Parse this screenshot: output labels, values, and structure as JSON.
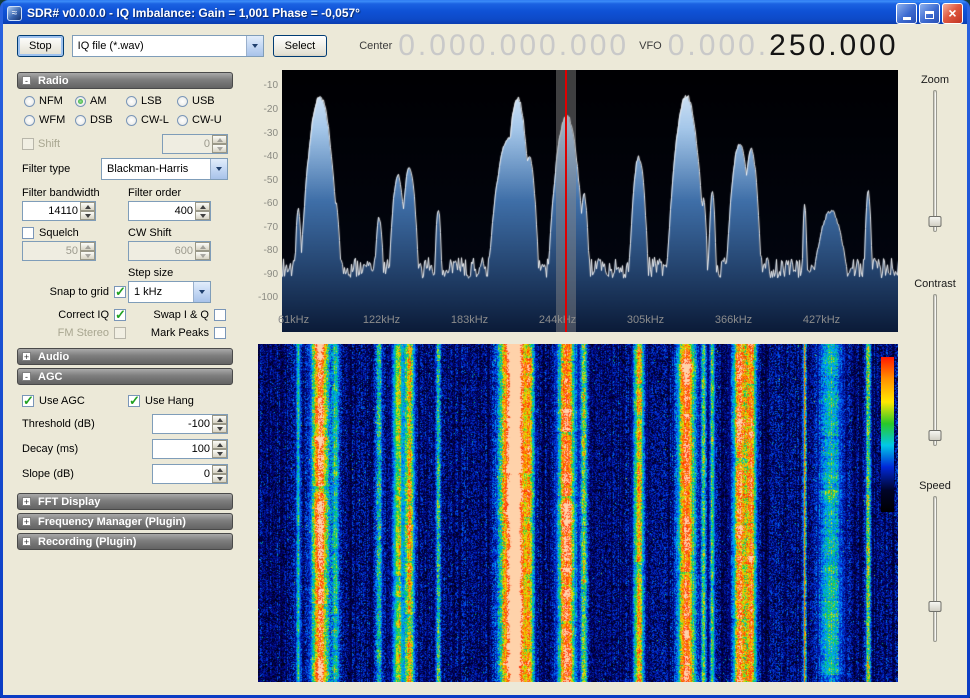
{
  "window": {
    "title": "SDR# v0.0.0.0 - IQ Imbalance: Gain = 1,001 Phase = -0,057°"
  },
  "toolbar": {
    "stop": "Stop",
    "source": "IQ file (*.wav)",
    "select": "Select",
    "center_label": "Center",
    "center_value": "0.000.000.000",
    "vfo_label": "VFO",
    "vfo_dim": "0.000.",
    "vfo_active": "250.000"
  },
  "panels": {
    "radio": {
      "title": "Radio",
      "glyph": "-",
      "modes": [
        {
          "label": "NFM",
          "selected": false
        },
        {
          "label": "AM",
          "selected": true
        },
        {
          "label": "LSB",
          "selected": false
        },
        {
          "label": "USB",
          "selected": false
        },
        {
          "label": "WFM",
          "selected": false
        },
        {
          "label": "DSB",
          "selected": false
        },
        {
          "label": "CW-L",
          "selected": false
        },
        {
          "label": "CW-U",
          "selected": false
        }
      ],
      "shift": {
        "label": "Shift",
        "value": "0",
        "checked": false,
        "enabled": false
      },
      "filter_type": {
        "label": "Filter type",
        "value": "Blackman-Harris"
      },
      "filter_bandwidth": {
        "label": "Filter bandwidth",
        "value": "14110"
      },
      "filter_order": {
        "label": "Filter order",
        "value": "400"
      },
      "squelch": {
        "label": "Squelch",
        "value": "50",
        "checked": false,
        "enabled": false
      },
      "cw_shift": {
        "label": "CW Shift",
        "value": "600",
        "enabled": false
      },
      "step_size": {
        "label": "Step size",
        "value": "1 kHz"
      },
      "snap_to_grid": {
        "label": "Snap to grid",
        "checked": true
      },
      "correct_iq": {
        "label": "Correct IQ",
        "checked": true
      },
      "swap_iq": {
        "label": "Swap I & Q",
        "checked": false
      },
      "fm_stereo": {
        "label": "FM Stereo",
        "checked": false,
        "enabled": false
      },
      "mark_peaks": {
        "label": "Mark Peaks",
        "checked": false
      }
    },
    "audio": {
      "title": "Audio",
      "glyph": "+"
    },
    "agc": {
      "title": "AGC",
      "glyph": "-",
      "use_agc": {
        "label": "Use AGC",
        "checked": true
      },
      "use_hang": {
        "label": "Use Hang",
        "checked": true
      },
      "threshold": {
        "label": "Threshold (dB)",
        "value": "-100"
      },
      "decay": {
        "label": "Decay (ms)",
        "value": "100"
      },
      "slope": {
        "label": "Slope (dB)",
        "value": "0"
      }
    },
    "fft": {
      "title": "FFT Display",
      "glyph": "+"
    },
    "freq_manager": {
      "title": "Frequency Manager (Plugin)",
      "glyph": "+"
    },
    "recording": {
      "title": "Recording (Plugin)",
      "glyph": "+"
    }
  },
  "sliders": [
    {
      "label": "Zoom",
      "position": 0.97
    },
    {
      "label": "Contrast",
      "position": 0.97
    },
    {
      "label": "Speed",
      "position": 0.78
    }
  ],
  "chart_data": {
    "type": "area",
    "title": "FFT spectrum with waterfall",
    "x_axis": {
      "tick_labels": [
        "61kHz",
        "122kHz",
        "183kHz",
        "244kHz",
        "305kHz",
        "366kHz",
        "427kHz"
      ],
      "ticks_khz": [
        61,
        122,
        183,
        244,
        305,
        366,
        427
      ],
      "range_khz": [
        53,
        480
      ]
    },
    "y_axis": {
      "ticks_db": [
        -10,
        -20,
        -30,
        -40,
        -50,
        -60,
        -70,
        -80,
        -90,
        -100
      ],
      "range_db": [
        -3,
        -105
      ]
    },
    "noise_floor_db": -87,
    "vfo": {
      "khz": 250,
      "bandwidth_khz": 14.1
    },
    "peaks": [
      {
        "khz": 64,
        "db": -62,
        "w": 1.5
      },
      {
        "khz": 79,
        "db": -14,
        "w": 5
      },
      {
        "khz": 90,
        "db": -60,
        "w": 2
      },
      {
        "khz": 120,
        "db": -66,
        "w": 2
      },
      {
        "khz": 133,
        "db": -48,
        "w": 3
      },
      {
        "khz": 141,
        "db": -44,
        "w": 3
      },
      {
        "khz": 161,
        "db": -62,
        "w": 1.5
      },
      {
        "khz": 210,
        "db": -32,
        "w": 6
      },
      {
        "khz": 216,
        "db": -15,
        "w": 4
      },
      {
        "khz": 224,
        "db": -40,
        "w": 3
      },
      {
        "khz": 250,
        "db": -22,
        "w": 5
      },
      {
        "khz": 262,
        "db": -56,
        "w": 2
      },
      {
        "khz": 300,
        "db": -40,
        "w": 3
      },
      {
        "khz": 333,
        "db": -14,
        "w": 5
      },
      {
        "khz": 345,
        "db": -58,
        "w": 1.5
      },
      {
        "khz": 351,
        "db": -55,
        "w": 1.5
      },
      {
        "khz": 370,
        "db": -34,
        "w": 4
      },
      {
        "khz": 378,
        "db": -37,
        "w": 3
      },
      {
        "khz": 415,
        "db": -60,
        "w": 1
      },
      {
        "khz": 433,
        "db": -63,
        "w": 7
      },
      {
        "khz": 459,
        "db": -55,
        "w": 1.5
      }
    ]
  },
  "waterfall": {
    "persistent_lines_khz": [
      250,
      415
    ],
    "legend_colors": [
      "#ff1800",
      "#ff9000",
      "#ffe800",
      "#28c828",
      "#00c8e8",
      "#0028d8",
      "#000428",
      "#000000"
    ]
  }
}
